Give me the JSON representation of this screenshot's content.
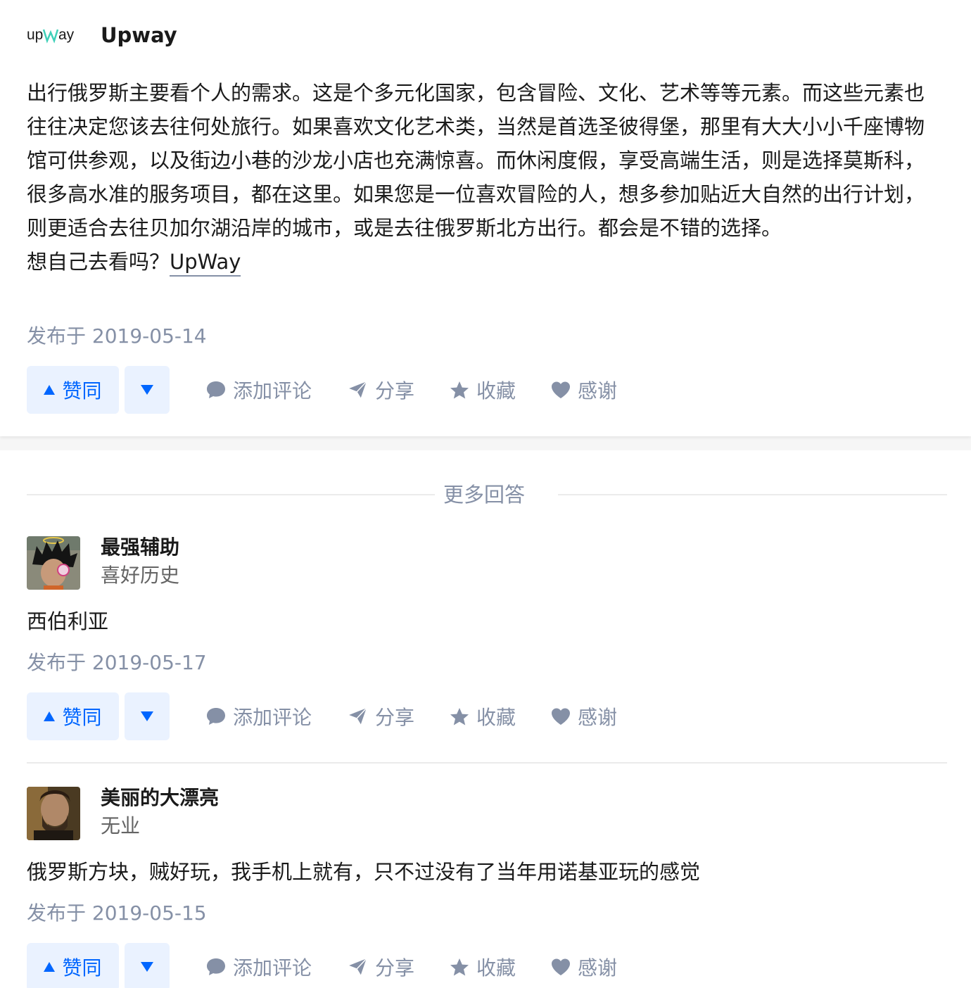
{
  "answer1": {
    "logo_text": "upWay",
    "author": "Upway",
    "paragraph": "出行俄罗斯主要看个人的需求。这是个多元化国家，包含冒险、文化、艺术等等元素。而这些元素也往往决定您该去往何处旅行。如果喜欢文化艺术类，当然是首选圣彼得堡，那里有大大小小千座博物馆可供参观，以及街边小巷的沙龙小店也充满惊喜。而休闲度假，享受高端生活，则是选择莫斯科，很多高水准的服务项目，都在这里。如果您是一位喜欢冒险的人，想多参加贴近大自然的出行计划，则更适合去往贝加尔湖沿岸的城市，或是去往俄罗斯北方出行。都会是不错的选择。",
    "prompt": "想自己去看吗？",
    "link": "UpWay",
    "date": "发布于 2019-05-14"
  },
  "more_answers_label": "更多回答",
  "answer2": {
    "author": "最强辅助",
    "bio": "喜好历史",
    "content": "西伯利亚",
    "date": "发布于 2019-05-17"
  },
  "answer3": {
    "author": "美丽的大漂亮",
    "bio": "无业",
    "content": "俄罗斯方块，贼好玩，我手机上就有，只不过没有了当年用诺基亚玩的感觉",
    "date": "发布于 2019-05-15"
  },
  "actions": {
    "upvote": "赞同",
    "comment": "添加评论",
    "share": "分享",
    "favorite": "收藏",
    "thanks": "感谢"
  },
  "colors": {
    "primary": "#0066ff",
    "vote_bg": "#eaf2ff",
    "muted": "#8590a6",
    "text": "#1a1a1a"
  }
}
